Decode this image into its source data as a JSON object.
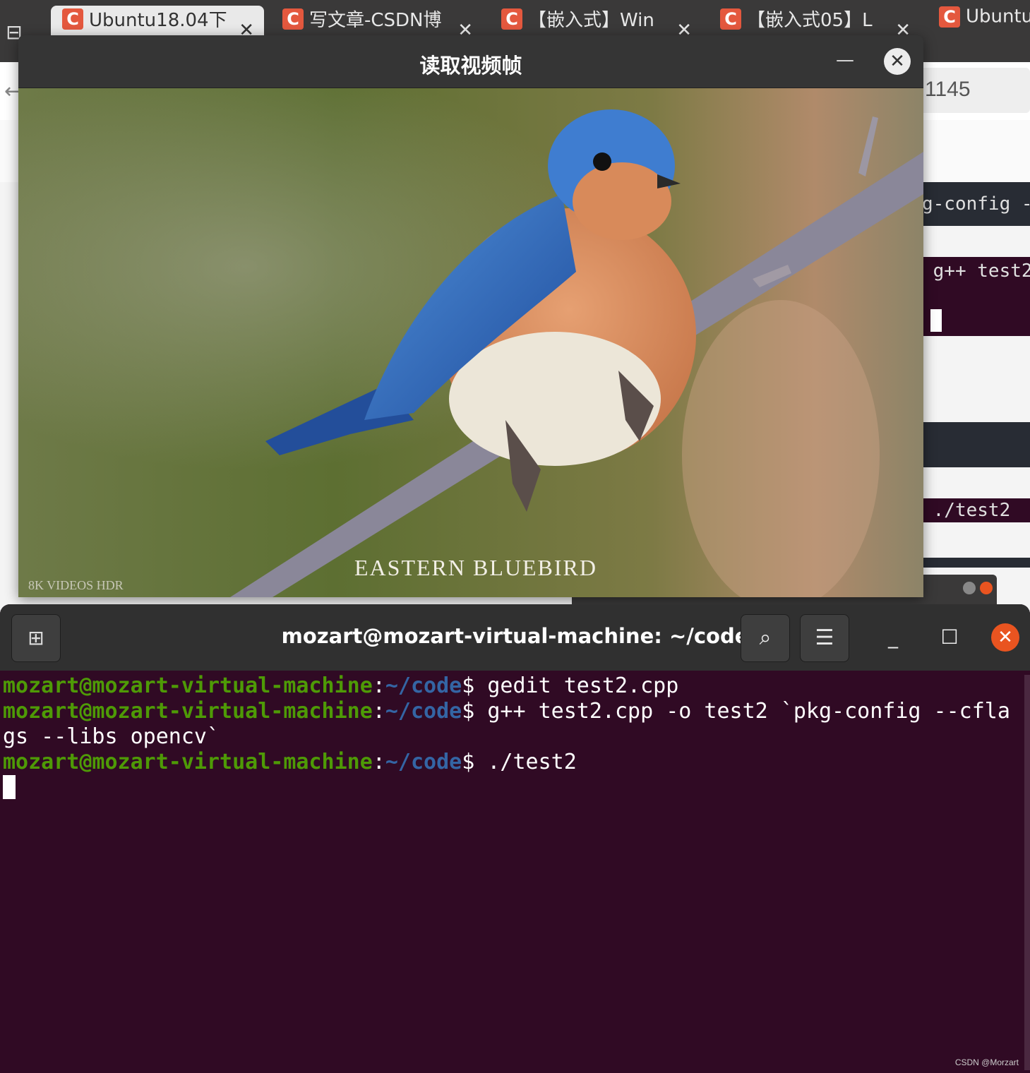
{
  "browser": {
    "tabs": [
      {
        "favicon": "C",
        "title": "Ubuntu18.04下",
        "active": true
      },
      {
        "favicon": "C",
        "title": "写文章-CSDN博",
        "active": false
      },
      {
        "favicon": "C",
        "title": "【嵌入式】Win",
        "active": false
      },
      {
        "favicon": "C",
        "title": "【嵌入式05】L",
        "active": false
      },
      {
        "favicon": "C",
        "title": "Ubuntu",
        "active": false
      }
    ],
    "url_fragment": "1145",
    "snippets": {
      "pkg": "g-config -",
      "gpp": "g++ test2",
      "run": "./test2"
    }
  },
  "video_window": {
    "title": "读取视频帧",
    "caption": "EASTERN BLUEBIRD",
    "watermark": "8K VIDEOS HDR"
  },
  "terminal": {
    "title": "mozart@mozart-virtual-machine: ~/code",
    "prompt_user": "mozart@mozart-virtual-machine",
    "prompt_colon": ":",
    "prompt_path": "~/code",
    "prompt_symbol": "$ ",
    "commands": [
      "gedit test2.cpp",
      "g++ test2.cpp -o test2 `pkg-config --cflags --libs opencv`",
      "./test2"
    ]
  },
  "colors": {
    "terminal_bg": "#300a24",
    "prompt_user": "#4e9a06",
    "prompt_path": "#3465a4",
    "close_button": "#e95420",
    "favicon": "#e4583e"
  },
  "icons": {
    "new_tab": "new-tab-icon",
    "search": "search-icon",
    "menu": "hamburger-menu-icon",
    "minimize": "minimize-icon",
    "maximize": "maximize-icon",
    "close": "close-icon"
  },
  "page_watermark": "CSDN @Morzart"
}
